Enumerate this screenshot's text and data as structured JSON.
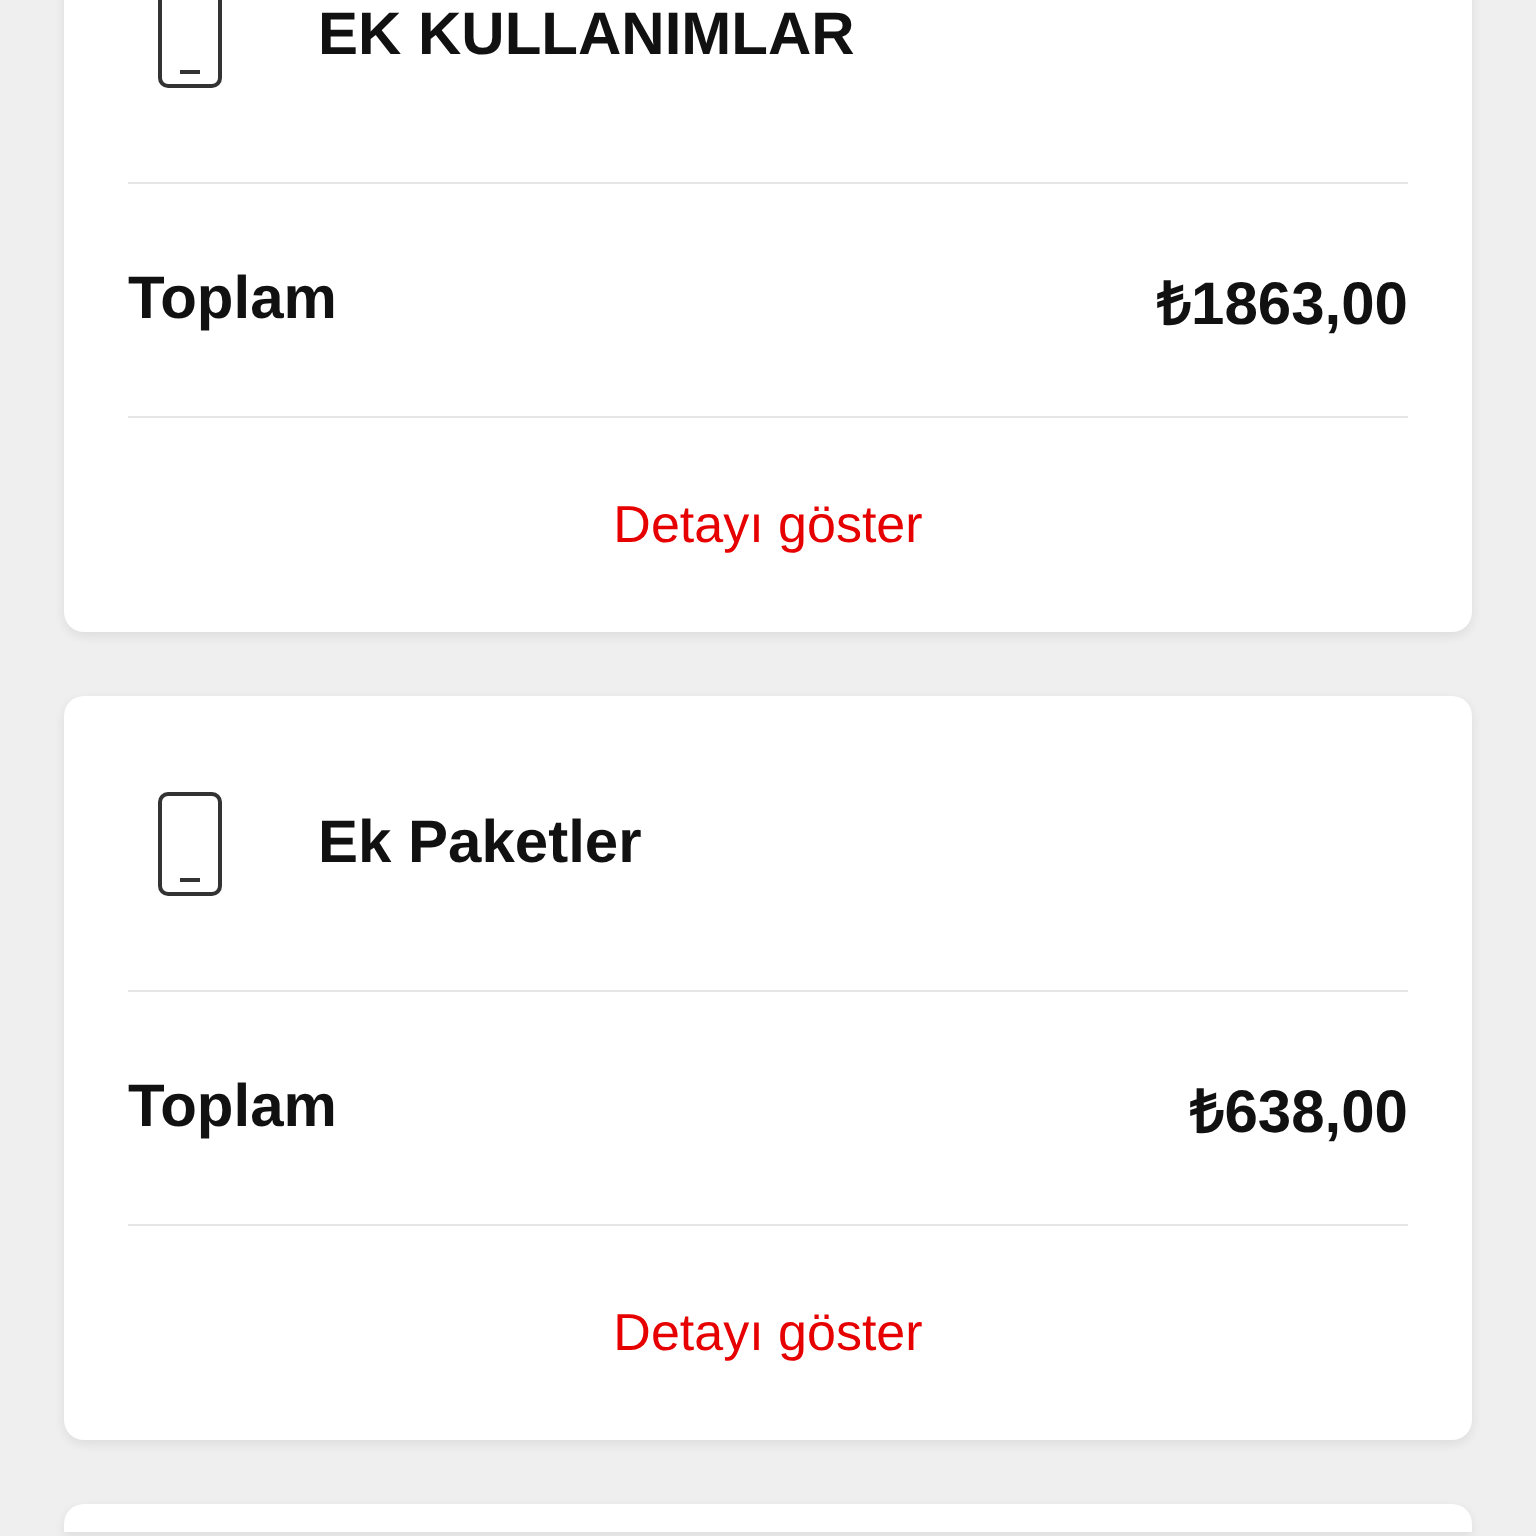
{
  "cards": [
    {
      "title": "EK KULLANIMLAR",
      "total_label": "Toplam",
      "total": "₺1863,00",
      "link": "Detayı göster"
    },
    {
      "title": "Ek Paketler",
      "total_label": "Toplam",
      "total": "₺638,00",
      "link": "Detayı göster"
    }
  ]
}
